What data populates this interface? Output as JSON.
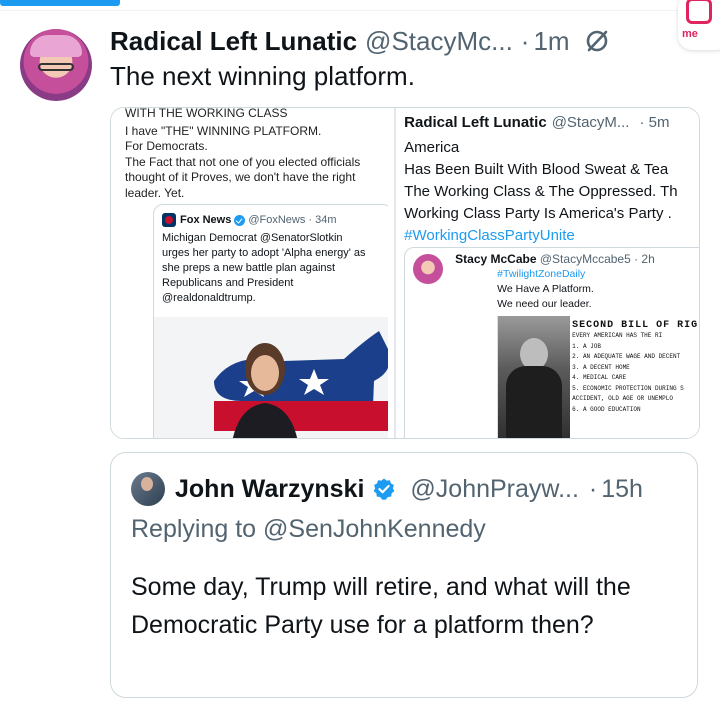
{
  "post": {
    "author_name": "Radical Left Lunatic",
    "author_handle": "@StacyMc...",
    "separator": "·",
    "time": "1m",
    "text": "The next winning platform."
  },
  "media_left": {
    "text_lines": [
      "WITH THE WORKING CLASS",
      "I have \"THE\" WINNING PLATFORM.",
      "For Democrats.",
      "The Fact that not one of you elected officials",
      "thought of it Proves, we don't have the right",
      "leader. Yet."
    ],
    "card": {
      "source_name": "Fox News",
      "source_handle": "@FoxNews · 34m",
      "body_lines": [
        "Michigan Democrat @SenatorSlotkin",
        "urges her party to adopt 'Alpha energy' as",
        "she preps a new battle plan against",
        "Republicans and President",
        "@realdonaldtrump."
      ]
    }
  },
  "media_right": {
    "author_name": "Radical Left Lunatic",
    "author_handle": "@StacyM...",
    "time": "· 5m",
    "body_lines": [
      "America",
      " Has Been Built With Blood Sweat & Tea",
      "The Working Class & The Oppressed. Th",
      "Working Class Party Is America's Party ."
    ],
    "hashtag": "#WorkingClassPartyUnite",
    "quote": {
      "author_name": "Stacy McCabe",
      "author_handle": "@StacyMccabe5 · 2h",
      "hashtag": "#TwilightZoneDaily",
      "lines": [
        "We Have A Platform.",
        "We need our leader."
      ],
      "doc_title": "SECOND BILL OF RIG",
      "doc_lines": [
        "EVERY AMERICAN HAS THE RI",
        "1. A JOB",
        "2. AN ADEQUATE WAGE AND DECENT",
        "3. A DECENT HOME",
        "4. MEDICAL CARE",
        "5. ECONOMIC PROTECTION DURING S",
        "   ACCIDENT, OLD AGE OR UNEMPLO",
        "6. A GOOD EDUCATION"
      ]
    }
  },
  "quoted_tweet": {
    "author_name": "John Warzynski",
    "author_handle": "@JohnPrayw...",
    "separator": "·",
    "time": "15h",
    "reply_to": "Replying to @SenJohnKennedy",
    "text": "Some day, Trump will retire, and what will the Democratic Party use for a platform then?"
  },
  "corner_badge": {
    "text": "me"
  },
  "colors": {
    "accent": "#1d9bf0",
    "text_primary": "#0f1419",
    "text_secondary": "#536471",
    "border": "#cfd9de"
  }
}
